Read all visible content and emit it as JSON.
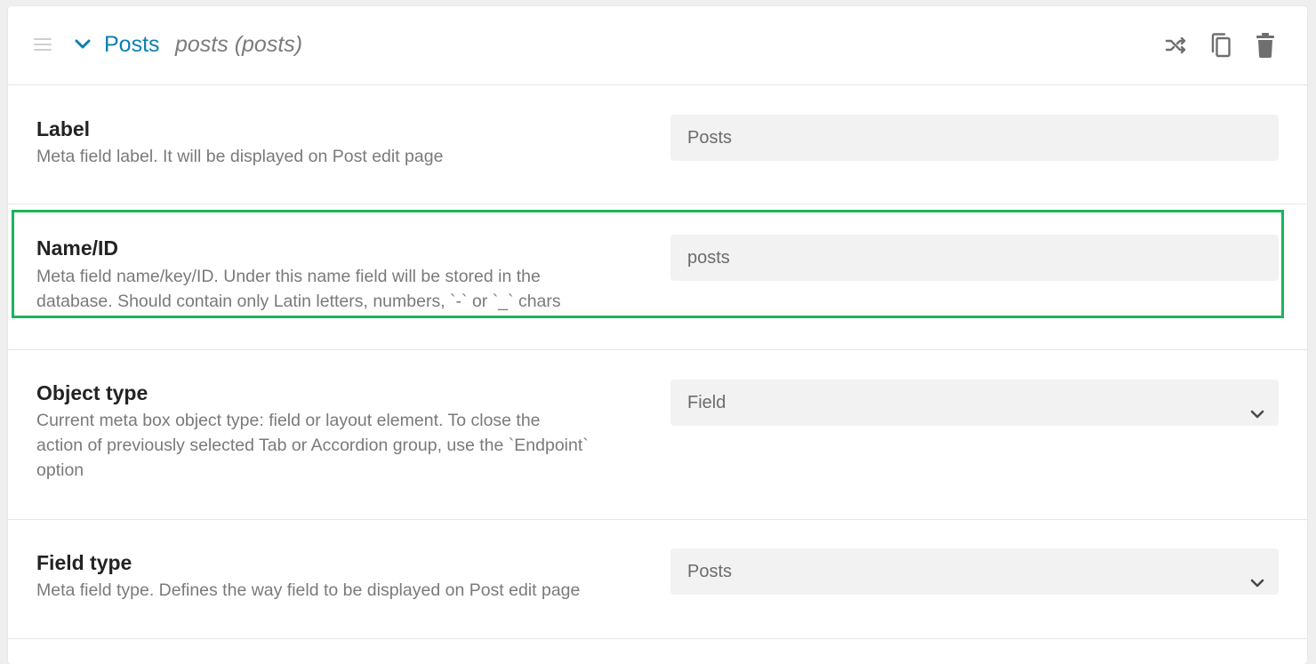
{
  "header": {
    "title": "Posts",
    "subtitle": "posts (posts)"
  },
  "fields": {
    "label": {
      "title": "Label",
      "description": "Meta field label. It will be displayed on Post edit page",
      "value": "Posts"
    },
    "name_id": {
      "title": "Name/ID",
      "description_line1": "Meta field name/key/ID. Under this name field will be stored in the",
      "description_line2": "database. Should contain only Latin letters, numbers, `-` or `_` chars",
      "value": "posts"
    },
    "object_type": {
      "title": "Object type",
      "description_line1": "Current meta box object type: field or layout element. To close the",
      "description_line2": "action of previously selected Tab or Accordion group, use the `Endpoint`",
      "description_line3": "option",
      "value": "Field"
    },
    "field_type": {
      "title": "Field type",
      "description": "Meta field type. Defines the way field to be displayed on Post edit page",
      "value": "Posts"
    }
  },
  "icons": {
    "drag": "drag-handle-icon",
    "toggle": "chevron-down-icon",
    "shuffle": "shuffle-icon",
    "copy": "copy-icon",
    "delete": "trash-icon"
  },
  "colors": {
    "accent": "#0d7fb0",
    "highlight": "#1bb35c",
    "icon": "#6f6f6f"
  }
}
